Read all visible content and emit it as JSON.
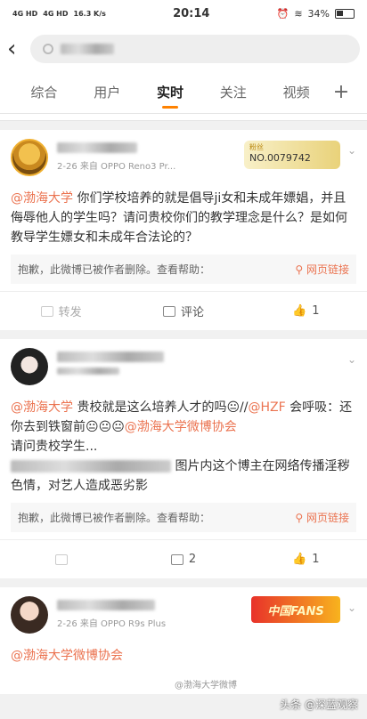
{
  "status": {
    "left": [
      "4G HD",
      "4G HD"
    ],
    "speed": "16.3 K/s",
    "time": "20:14",
    "battery": "34%"
  },
  "search": {
    "query": ""
  },
  "tabs": [
    "综合",
    "用户",
    "实时",
    "关注",
    "视频"
  ],
  "posts": [
    {
      "date_source": "2-26 来自 OPPO Reno3 Pr...",
      "badge_title": "粉丝",
      "badge_no": "NO.0079742",
      "mention": "@渤海大学",
      "text": " 你们学校培养的就是倡导ji女和未成年嫖娼，并且侮辱他人的学生吗？请问贵校你们的教学理念是什么？是如何教导学生嫖女和未成年合法论的？",
      "deleted_note": "抱歉，此微博已被作者删除。查看帮助：",
      "link_text": "网页链接",
      "repost": "转发",
      "comment": "评论",
      "like": "1"
    },
    {
      "mention": "@渤海大学",
      "text1": " 贵校就是这么培养人才的吗😐//",
      "mention2": "@HZF",
      "text2": "会呼吸：还你去到铁窗前😐😐😐",
      "mention3": "@渤海大学微博协会",
      "text3": "请问贵校学生...",
      "text4": "图片内这个博主在网络传播淫秽色情，对艺人造成恶劣影",
      "deleted_note": "抱歉，此微博已被作者删除。查看帮助：",
      "link_text": "网页链接",
      "comment": "2",
      "like": "1"
    },
    {
      "date_source": "2-26 来自 OPPO R9s Plus",
      "badge_text": "中国FANS",
      "mention": "@渤海大学微博协会"
    }
  ],
  "watermark": "头条 @深蓝观察",
  "watermark2": "@渤海大学微博"
}
